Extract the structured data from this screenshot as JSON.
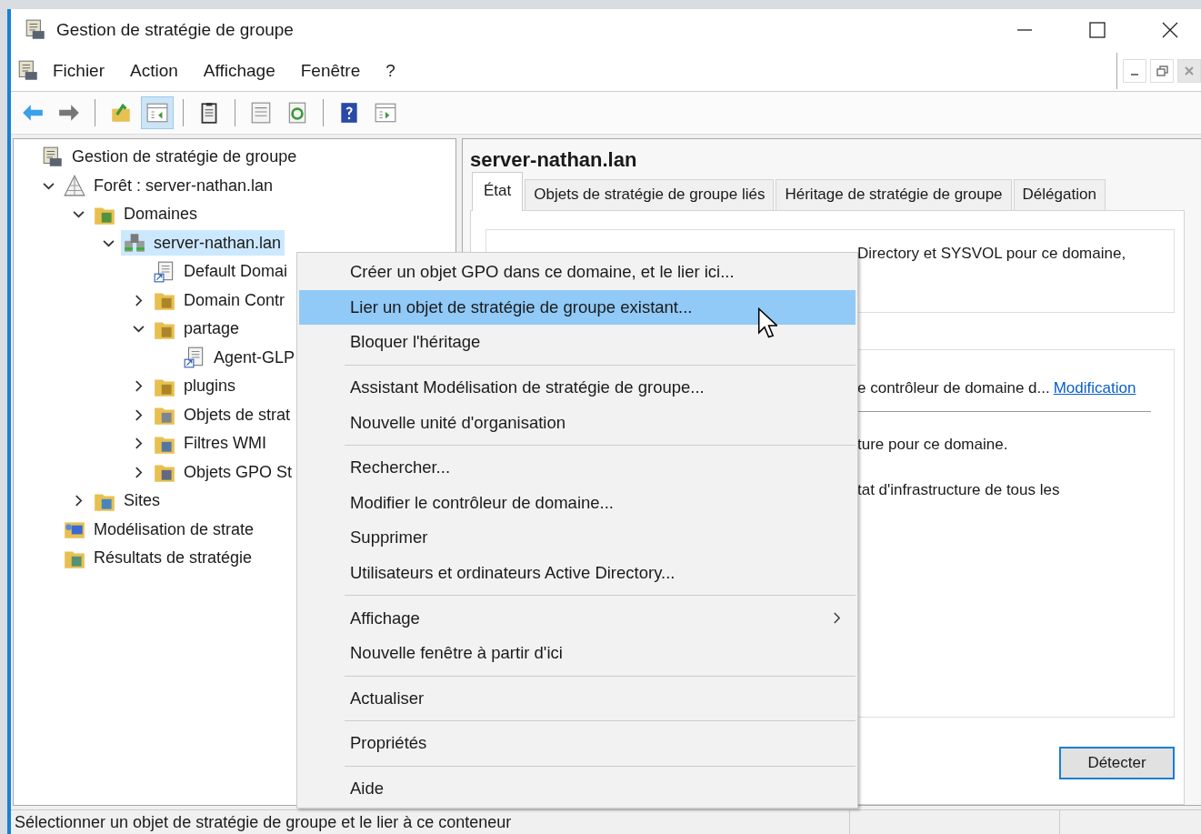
{
  "window": {
    "title": "Gestion de stratégie de groupe"
  },
  "menu_bar": [
    "Fichier",
    "Action",
    "Affichage",
    "Fenêtre",
    "?"
  ],
  "toolbar": [
    {
      "kind": "back",
      "pressed": false
    },
    {
      "kind": "forward",
      "pressed": false
    },
    {
      "kind": "separator"
    },
    {
      "kind": "up",
      "pressed": false
    },
    {
      "kind": "console-tree",
      "pressed": true
    },
    {
      "kind": "separator"
    },
    {
      "kind": "export",
      "pressed": false
    },
    {
      "kind": "separator"
    },
    {
      "kind": "properties",
      "pressed": false
    },
    {
      "kind": "refresh",
      "pressed": false
    },
    {
      "kind": "separator"
    },
    {
      "kind": "help",
      "pressed": false
    },
    {
      "kind": "action-pane",
      "pressed": false
    }
  ],
  "tree": [
    {
      "label": "Gestion de stratégie de groupe",
      "kind": "console",
      "selected": false,
      "children": [
        {
          "label": "Forêt : server-nathan.lan",
          "kind": "forest",
          "selected": false,
          "expanded": true,
          "children": [
            {
              "label": "Domaines",
              "kind": "domains",
              "selected": false,
              "expanded": true,
              "children": [
                {
                  "label": "server-nathan.lan",
                  "kind": "domain",
                  "selected": true,
                  "expanded": true,
                  "children": [
                    {
                      "label": "Default Domai",
                      "kind": "gpo-link",
                      "selected": false
                    },
                    {
                      "label": "Domain Contr",
                      "kind": "ou",
                      "selected": false,
                      "expanded": false
                    },
                    {
                      "label": "partage",
                      "kind": "ou",
                      "selected": false,
                      "expanded": true,
                      "children": [
                        {
                          "label": "Agent-GLP",
                          "kind": "gpo-link",
                          "selected": false
                        }
                      ]
                    },
                    {
                      "label": "plugins",
                      "kind": "ou",
                      "selected": false,
                      "expanded": false
                    },
                    {
                      "label": "Objets de strat",
                      "kind": "gpo-folder",
                      "selected": false,
                      "expanded": false
                    },
                    {
                      "label": "Filtres WMI",
                      "kind": "wmi-folder",
                      "selected": false,
                      "expanded": false
                    },
                    {
                      "label": "Objets GPO St",
                      "kind": "starter-folder",
                      "selected": false,
                      "expanded": false
                    }
                  ]
                }
              ]
            },
            {
              "label": "Sites",
              "kind": "sites",
              "selected": false,
              "expanded": false
            }
          ]
        },
        {
          "label": "Modélisation de strate",
          "kind": "modeling",
          "selected": false
        },
        {
          "label": "Résultats de stratégie",
          "kind": "results",
          "selected": false
        }
      ]
    }
  ],
  "details": {
    "heading": "server-nathan.lan",
    "tabs": [
      {
        "label": "État",
        "selected": true
      },
      {
        "label": "Objets de stratégie de groupe liés",
        "selected": false
      },
      {
        "label": "Héritage de stratégie de groupe",
        "selected": false
      },
      {
        "label": "Délégation",
        "selected": false
      }
    ],
    "summary_text": "Directory et SYSVOL pour ce domaine,",
    "controller_text": "e contrôleur de domaine d...",
    "controller_link": "Modification",
    "lines": [
      "ture pour ce domaine.",
      "tat d'infrastructure de tous les"
    ],
    "detect_button": "Détecter"
  },
  "context_menu": {
    "groups": [
      [
        {
          "label": "Créer un objet GPO dans ce domaine, et le lier ici...",
          "selected": false
        },
        {
          "label": "Lier un objet de stratégie de groupe existant...",
          "selected": true
        },
        {
          "label": "Bloquer l'héritage",
          "selected": false
        }
      ],
      [
        {
          "label": "Assistant Modélisation de stratégie de groupe...",
          "selected": false
        },
        {
          "label": "Nouvelle unité d'organisation",
          "selected": false
        }
      ],
      [
        {
          "label": "Rechercher...",
          "selected": false
        },
        {
          "label": "Modifier le contrôleur de domaine...",
          "selected": false
        },
        {
          "label": "Supprimer",
          "selected": false
        },
        {
          "label": "Utilisateurs et ordinateurs Active Directory...",
          "selected": false
        }
      ],
      [
        {
          "label": "Affichage",
          "selected": false,
          "submenu": true
        },
        {
          "label": "Nouvelle fenêtre à partir d'ici",
          "selected": false
        }
      ],
      [
        {
          "label": "Actualiser",
          "selected": false
        }
      ],
      [
        {
          "label": "Propriétés",
          "selected": false
        }
      ],
      [
        {
          "label": "Aide",
          "selected": false
        }
      ]
    ]
  },
  "status_bar": "Sélectionner un objet de stratégie de groupe et le lier à ce conteneur"
}
